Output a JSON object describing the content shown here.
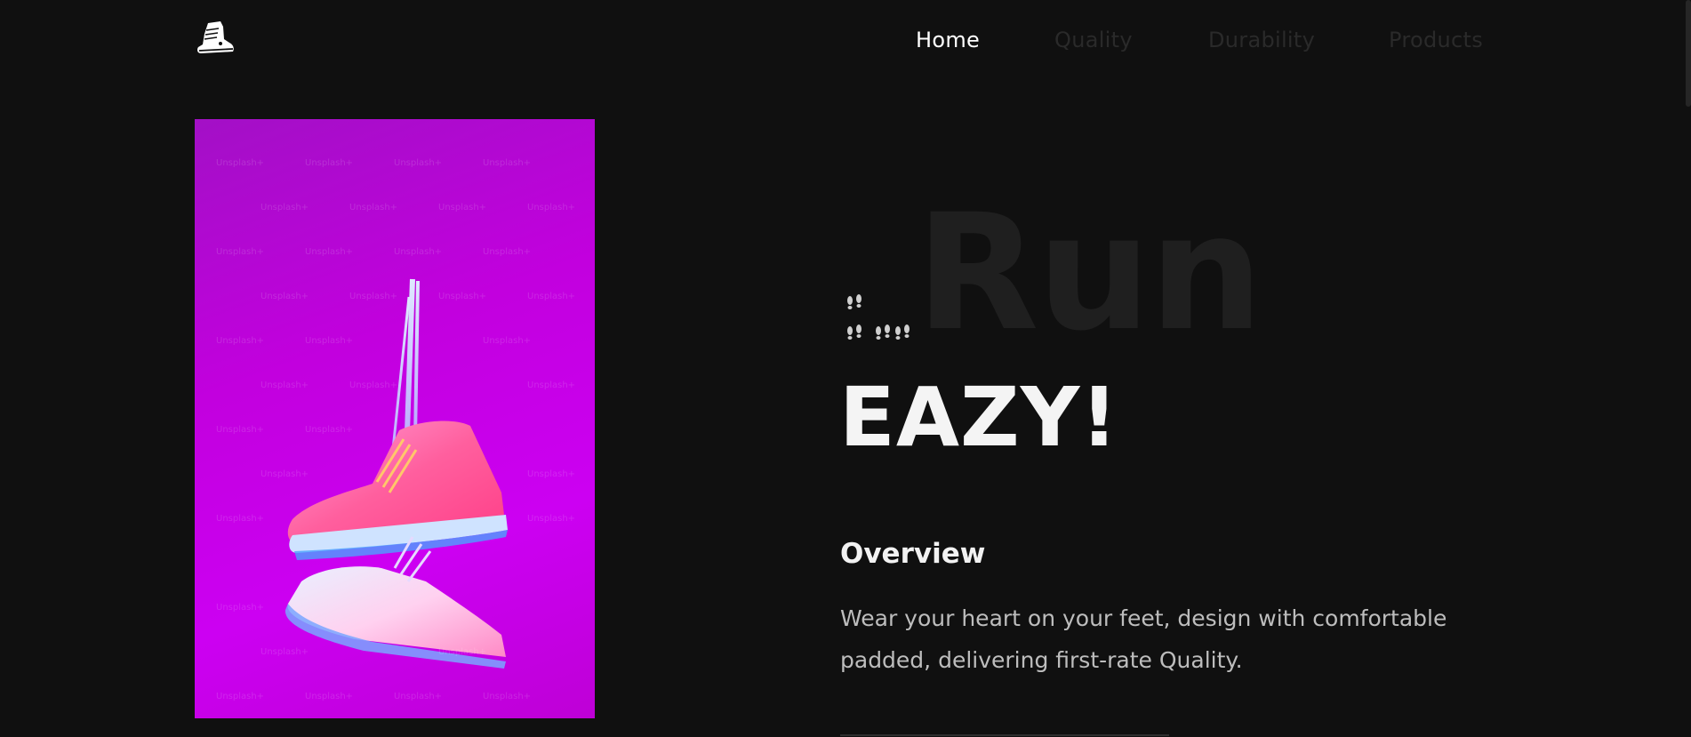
{
  "header": {
    "logo_icon": "sneaker-boot-icon",
    "nav": [
      {
        "label": "Home",
        "active": true
      },
      {
        "label": "Quality",
        "active": false
      },
      {
        "label": "Durability",
        "active": false
      },
      {
        "label": "Products",
        "active": false
      }
    ]
  },
  "hero": {
    "image_icon": "hanging-sneakers-photo",
    "watermark": "Unsplash+",
    "background_word": "Run",
    "steps_icon": "footprints-icon",
    "headline": "EAZY!",
    "overview_title": "Overview",
    "overview_text": "Wear your heart on your feet, design with comfortable padded, delivering first-rate Quality."
  },
  "colors": {
    "background": "#101010",
    "active_nav": "#ffffff",
    "inactive_nav": "#2a2a2a",
    "image_magenta": "#c200de",
    "text_muted": "#bdbdbd"
  }
}
